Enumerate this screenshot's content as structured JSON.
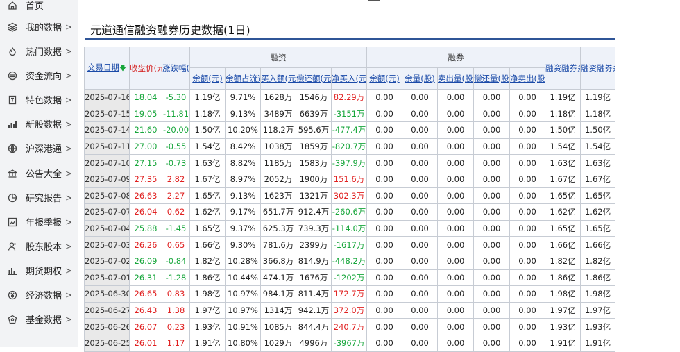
{
  "sidebar": {
    "items": [
      {
        "label": "首页",
        "icon": "home-icon",
        "chevron": ""
      },
      {
        "label": "我的数据",
        "icon": "layers-icon",
        "chevron": ">"
      },
      {
        "label": "热门数据",
        "icon": "flame-icon",
        "chevron": ">"
      },
      {
        "label": "资金流向",
        "icon": "flow-icon",
        "chevron": ">"
      },
      {
        "label": "特色数据",
        "icon": "bookmark-icon",
        "chevron": ">"
      },
      {
        "label": "新股数据",
        "icon": "bars-icon",
        "chevron": ">"
      },
      {
        "label": "沪深港通",
        "icon": "globe-icon",
        "chevron": ">"
      },
      {
        "label": "公告大全",
        "icon": "bank-icon",
        "chevron": ">"
      },
      {
        "label": "研究报告",
        "icon": "pie-icon",
        "chevron": ">"
      },
      {
        "label": "年报季报",
        "icon": "line-chart-icon",
        "chevron": ">"
      },
      {
        "label": "股东股本",
        "icon": "user-icon",
        "chevron": ">"
      },
      {
        "label": "期货期权",
        "icon": "column-chart-icon",
        "chevron": ">"
      },
      {
        "label": "经济数据",
        "icon": "yen-icon",
        "chevron": ">"
      },
      {
        "label": "基金数据",
        "icon": "fund-icon",
        "chevron": ">"
      }
    ]
  },
  "page": {
    "title": "元道通信融资融券历史数据(1日)"
  },
  "table": {
    "group_rz": "融资",
    "group_rq": "融券",
    "headers": {
      "date": "交易日期",
      "close": "收盘价(元)",
      "change": "涨跌幅(%)",
      "rz_balance": "余额(元)",
      "rz_ratio": "余额占流通市值比",
      "rz_buy": "买入额(元)",
      "rz_repay": "偿还额(元)",
      "rz_net": "净买入(元)",
      "rq_balance": "余额(元)",
      "rq_qty": "余量(股)",
      "rq_sell": "卖出量(股)",
      "rq_repay": "偿还量(股)",
      "rq_net": "净卖出(股)",
      "total_balance": "融资融券余额(元)",
      "diff": "融资融券余额差值(元)"
    },
    "rows": [
      [
        "2025-07-16",
        "18.04",
        "-5.30",
        "1.19亿",
        "9.71%",
        "1628万",
        "1546万",
        "82.29万",
        "0.00",
        "0.00",
        "0.00",
        "0.00",
        "0.00",
        "1.19亿",
        "1.19亿"
      ],
      [
        "2025-07-15",
        "19.05",
        "-11.81",
        "1.18亿",
        "9.13%",
        "3489万",
        "6639万",
        "-3151万",
        "0.00",
        "0.00",
        "0.00",
        "0.00",
        "0.00",
        "1.18亿",
        "1.18亿"
      ],
      [
        "2025-07-14",
        "21.60",
        "-20.00",
        "1.50亿",
        "10.20%",
        "118.2万",
        "595.6万",
        "-477.4万",
        "0.00",
        "0.00",
        "0.00",
        "0.00",
        "0.00",
        "1.50亿",
        "1.50亿"
      ],
      [
        "2025-07-11",
        "27.00",
        "-0.55",
        "1.54亿",
        "8.42%",
        "1038万",
        "1859万",
        "-820.7万",
        "0.00",
        "0.00",
        "0.00",
        "0.00",
        "0.00",
        "1.54亿",
        "1.54亿"
      ],
      [
        "2025-07-10",
        "27.15",
        "-0.73",
        "1.63亿",
        "8.82%",
        "1185万",
        "1583万",
        "-397.9万",
        "0.00",
        "0.00",
        "0.00",
        "0.00",
        "0.00",
        "1.63亿",
        "1.63亿"
      ],
      [
        "2025-07-09",
        "27.35",
        "2.82",
        "1.67亿",
        "8.97%",
        "2052万",
        "1900万",
        "151.6万",
        "0.00",
        "0.00",
        "0.00",
        "0.00",
        "0.00",
        "1.67亿",
        "1.67亿"
      ],
      [
        "2025-07-08",
        "26.63",
        "2.27",
        "1.65亿",
        "9.13%",
        "1623万",
        "1321万",
        "302.3万",
        "0.00",
        "0.00",
        "0.00",
        "0.00",
        "0.00",
        "1.65亿",
        "1.65亿"
      ],
      [
        "2025-07-07",
        "26.04",
        "0.62",
        "1.62亿",
        "9.17%",
        "651.7万",
        "912.4万",
        "-260.6万",
        "0.00",
        "0.00",
        "0.00",
        "0.00",
        "0.00",
        "1.62亿",
        "1.62亿"
      ],
      [
        "2025-07-04",
        "25.88",
        "-1.45",
        "1.65亿",
        "9.37%",
        "625.3万",
        "739.3万",
        "-114.0万",
        "0.00",
        "0.00",
        "0.00",
        "0.00",
        "0.00",
        "1.65亿",
        "1.65亿"
      ],
      [
        "2025-07-03",
        "26.26",
        "0.65",
        "1.66亿",
        "9.30%",
        "781.6万",
        "2399万",
        "-1617万",
        "0.00",
        "0.00",
        "0.00",
        "0.00",
        "0.00",
        "1.66亿",
        "1.66亿"
      ],
      [
        "2025-07-02",
        "26.09",
        "-0.84",
        "1.82亿",
        "10.28%",
        "366.8万",
        "814.9万",
        "-448.2万",
        "0.00",
        "0.00",
        "0.00",
        "0.00",
        "0.00",
        "1.82亿",
        "1.82亿"
      ],
      [
        "2025-07-01",
        "26.31",
        "-1.28",
        "1.86亿",
        "10.44%",
        "474.1万",
        "1676万",
        "-1202万",
        "0.00",
        "0.00",
        "0.00",
        "0.00",
        "0.00",
        "1.86亿",
        "1.86亿"
      ],
      [
        "2025-06-30",
        "26.65",
        "0.83",
        "1.98亿",
        "10.97%",
        "984.1万",
        "811.4万",
        "172.7万",
        "0.00",
        "0.00",
        "0.00",
        "0.00",
        "0.00",
        "1.98亿",
        "1.98亿"
      ],
      [
        "2025-06-27",
        "26.43",
        "1.38",
        "1.97亿",
        "10.97%",
        "1314万",
        "942.1万",
        "372.0万",
        "0.00",
        "0.00",
        "0.00",
        "0.00",
        "0.00",
        "1.97亿",
        "1.97亿"
      ],
      [
        "2025-06-26",
        "26.07",
        "0.23",
        "1.93亿",
        "10.91%",
        "1085万",
        "844.4万",
        "240.7万",
        "0.00",
        "0.00",
        "0.00",
        "0.00",
        "0.00",
        "1.93亿",
        "1.93亿"
      ],
      [
        "2025-06-25",
        "26.01",
        "1.17",
        "1.91亿",
        "10.80%",
        "1029万",
        "4996万",
        "-3967万",
        "0.00",
        "0.00",
        "0.00",
        "0.00",
        "0.00",
        "1.91亿",
        "1.91亿"
      ]
    ]
  }
}
